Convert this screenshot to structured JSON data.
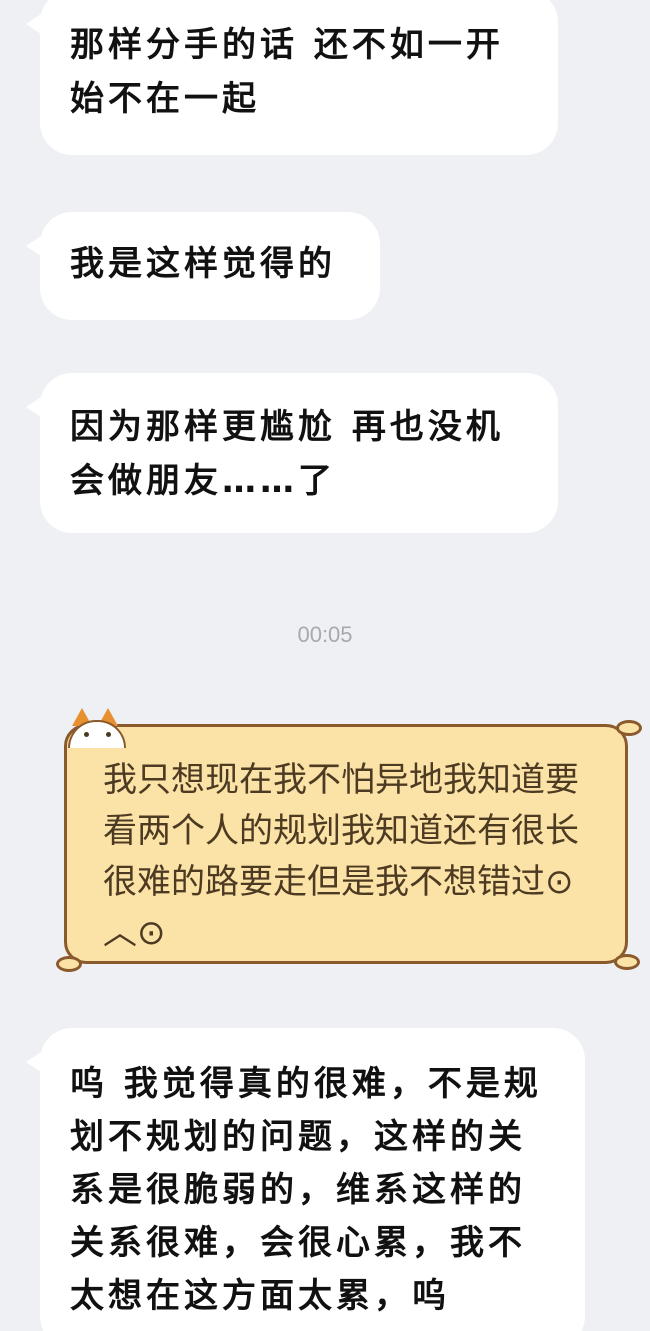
{
  "messages": [
    {
      "text": "那样分手的话 还不如一开始不在一起"
    },
    {
      "text": "我是这样觉得的"
    },
    {
      "text": "因为那样更尴尬 再也没机会做朋友……了"
    }
  ],
  "timestamp": "00:05",
  "sticker_message": {
    "text": "我只想现在我不怕异地我知道要看两个人的规划我知道还有很长很难的路要走但是我不想错过⊙︿⊙",
    "bg_color": "#fbe2a6",
    "border_color": "#8a5a2c"
  },
  "last_message": {
    "text": "呜 我觉得真的很难，不是规划不规划的问题，这样的关系是很脆弱的，维系这样的关系很难，会很心累，我不太想在这方面太累，呜"
  },
  "colors": {
    "background": "#eef0f4",
    "bubble": "#ffffff",
    "timestamp": "#a7a9ad"
  }
}
